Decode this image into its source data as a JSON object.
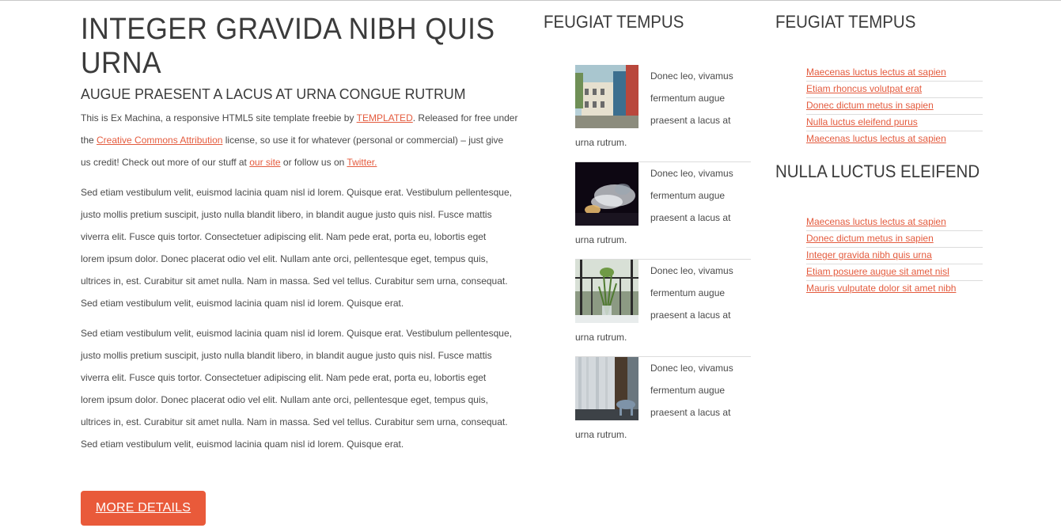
{
  "main": {
    "title": "INTEGER GRAVIDA NIBH QUIS URNA",
    "subtitle": "AUGUE PRAESENT A LACUS AT URNA CONGUE RUTRUM",
    "intro": {
      "t1": "This is Ex Machina, a responsive HTML5 site template freebie by ",
      "link1": "TEMPLATED",
      "t2": ". Released for free under",
      "t3": "the ",
      "link2": "Creative Commons Attribution",
      "t4": " license, so use it for whatever (personal or commercial) – just give",
      "t5": "us credit! Check out more of our stuff at ",
      "link3": "our site",
      "t6": " or follow us on ",
      "link4": "Twitter."
    },
    "para1": [
      "Sed etiam vestibulum velit, euismod lacinia quam nisl id lorem. Quisque erat. Vestibulum pellentesque,",
      "justo mollis pretium suscipit, justo nulla blandit libero, in blandit augue justo quis nisl. Fusce mattis",
      "viverra elit. Fusce quis tortor. Consectetuer adipiscing elit. Nam pede erat, porta eu, lobortis eget",
      "lorem ipsum dolor. Donec placerat odio vel elit. Nullam ante orci, pellentesque eget, tempus quis,",
      "ultrices in, est. Curabitur sit amet nulla. Nam in massa. Sed vel tellus. Curabitur sem urna, consequat.",
      "Sed etiam vestibulum velit, euismod lacinia quam nisl id lorem. Quisque erat."
    ],
    "para2": [
      "Sed etiam vestibulum velit, euismod lacinia quam nisl id lorem. Quisque erat. Vestibulum pellentesque,",
      "justo mollis pretium suscipit, justo nulla blandit libero, in blandit augue justo quis nisl. Fusce mattis",
      "viverra elit. Fusce quis tortor. Consectetuer adipiscing elit. Nam pede erat, porta eu, lobortis eget",
      "lorem ipsum dolor. Donec placerat odio vel elit. Nullam ante orci, pellentesque eget, tempus quis,",
      "ultrices in, est. Curabitur sit amet nulla. Nam in massa. Sed vel tellus. Curabitur sem urna, consequat.",
      "Sed etiam vestibulum velit, euismod lacinia quam nisl id lorem. Quisque erat."
    ],
    "button_label": "MORE DETAILS"
  },
  "middle": {
    "title": "FEUGIAT TEMPUS",
    "posts": [
      {
        "line1": "Donec leo, vivamus",
        "line2": "fermentum augue",
        "line3": "praesent a lacus at",
        "line4": "urna rutrum.",
        "image": "town-buildings-photo"
      },
      {
        "line1": "Donec leo, vivamus",
        "line2": "fermentum augue",
        "line3": "praesent a lacus at",
        "line4": "urna rutrum.",
        "image": "smoke-night-photo"
      },
      {
        "line1": "Donec leo, vivamus",
        "line2": "fermentum augue",
        "line3": "praesent a lacus at",
        "line4": "urna rutrum.",
        "image": "plant-vase-balcony-photo"
      },
      {
        "line1": "Donec leo, vivamus",
        "line2": "fermentum augue",
        "line3": "praesent a lacus at",
        "line4": "urna rutrum.",
        "image": "curtain-chair-photo"
      }
    ]
  },
  "right": {
    "title1": "FEUGIAT TEMPUS",
    "links1": [
      "Maecenas luctus lectus at sapien",
      "Etiam rhoncus volutpat erat",
      "Donec dictum metus in sapien",
      "Nulla luctus eleifend purus",
      "Maecenas luctus lectus at sapien"
    ],
    "title2": "NULLA LUCTUS ELEIFEND",
    "links2": [
      "Maecenas luctus lectus at sapien",
      "Donec dictum metus in sapien",
      "Integer gravida nibh quis urna",
      "Etiam posuere augue sit amet nisl",
      "Mauris vulputate dolor sit amet nibh"
    ]
  },
  "colors": {
    "accent": "#e95a3a",
    "link": "#e45b3e",
    "heading": "#3b3b3b",
    "text": "#4a4a4a"
  }
}
